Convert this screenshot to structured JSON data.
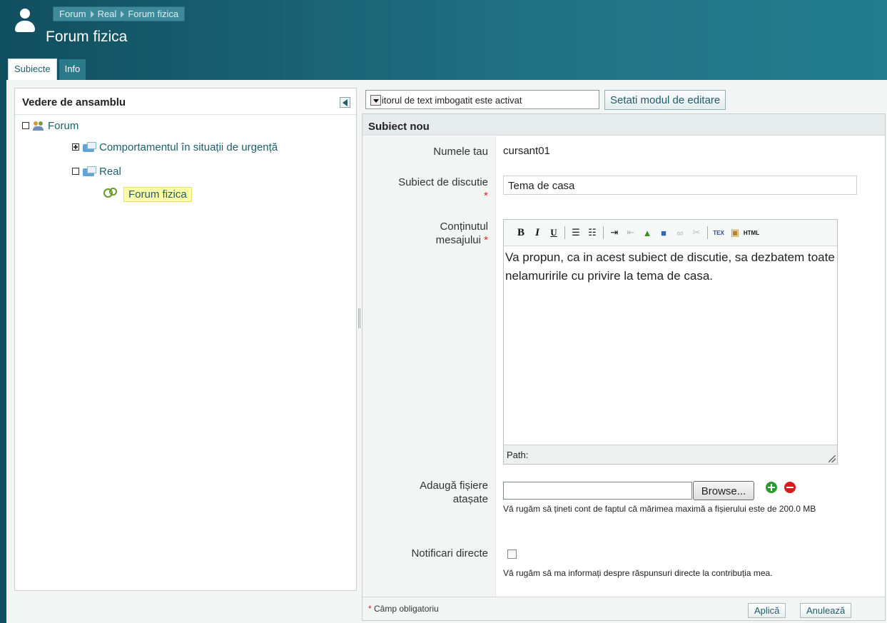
{
  "breadcrumb": [
    "Forum",
    "Real",
    "Forum fizica"
  ],
  "page_title": "Forum fizica",
  "tabs": [
    {
      "label": "Subiecte",
      "active": true
    },
    {
      "label": "Info",
      "active": false
    }
  ],
  "overview": {
    "title": "Vedere de ansamblu",
    "tree": {
      "root": "Forum",
      "child1": "Comportamentul în situații de urgență",
      "child2": "Real",
      "leaf": "Forum fizica"
    }
  },
  "editor_mode": {
    "selected": "Editorul de text imbogatit este activat",
    "set_button": "Setati modul de editare"
  },
  "form": {
    "section_title": "Subiect nou",
    "name_label": "Numele tau",
    "name_value": "cursant01",
    "subject_label": "Subiect de discutie",
    "subject_value": "Tema de casa",
    "content_label_1": "Conținutul",
    "content_label_2": "mesajului",
    "content_text": "Va propun, ca in acest subiect de discutie, sa dezbatem toate nelamuririle cu privire la tema de casa.",
    "path_label": "Path:",
    "attach_label_1": "Adaugă fișiere",
    "attach_label_2": "atașate",
    "browse_button": "Browse...",
    "attach_hint": "Vă rugăm să țineti cont de faptul că mărimea maximă a fișierului este de 200.0 MB",
    "notify_label": "Notificari directe",
    "notify_hint": "Vă rugăm să ma informați despre răspunsuri directe la contribuția mea.",
    "notify_checked": false,
    "required_marker": "*",
    "required_note": "Câmp obligatoriu",
    "apply_button": "Aplică",
    "cancel_button": "Anulează"
  },
  "toolbar_icons": [
    "bold-icon",
    "italic-icon",
    "underline-icon",
    "bullet-list-icon",
    "numbered-list-icon",
    "indent-icon",
    "outdent-icon",
    "image-icon",
    "media-icon",
    "link-icon",
    "unlink-icon",
    "tex-icon",
    "paste-icon",
    "html-icon"
  ],
  "colors": {
    "header": "#1a6878",
    "accent": "#1d5d6c",
    "required": "#dd2222",
    "selected": "#ffffa8"
  }
}
